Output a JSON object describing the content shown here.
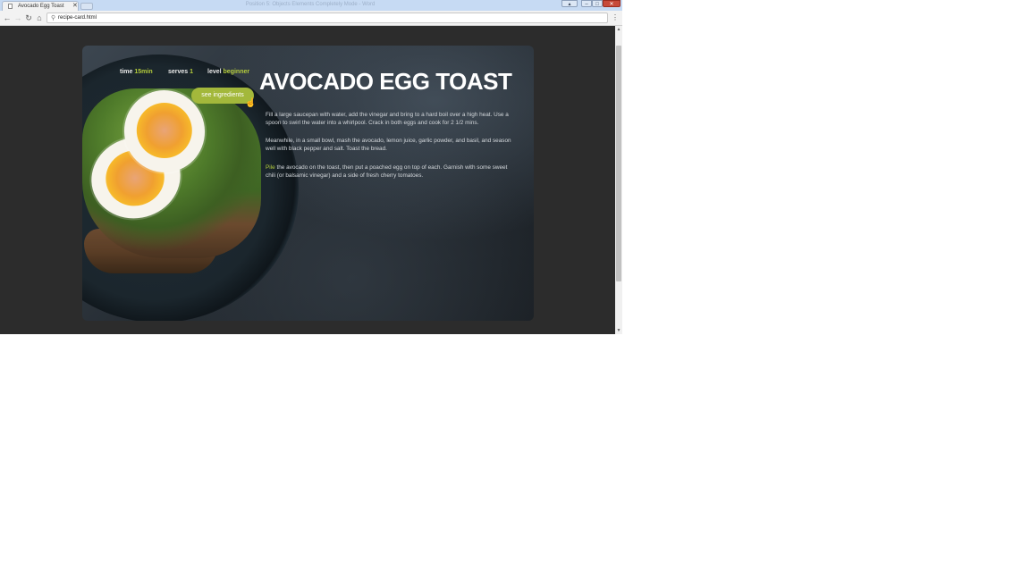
{
  "browser": {
    "tab_title": "Avocado Egg Toast",
    "window_title": "Position 5: Objects Elements Completely Mode - Word",
    "address": "recipe-card.html"
  },
  "recipe": {
    "title": "AVOCADO EGG TOAST",
    "meta": {
      "time_label": "time",
      "time_value": "15min",
      "serves_label": "serves",
      "serves_value": "1",
      "level_label": "level",
      "level_value": "beginner"
    },
    "button_label": "see ingredients",
    "steps": [
      {
        "text": "Fill a large saucepan with water, add the vinegar and bring to a hard boil over a high heat. Use a spoon to swirl the water into a whirlpool. Crack in both eggs and cook for 2 1/2 mins."
      },
      {
        "text": "Meanwhile, in a small bowl, mash the avocado, lemon juice, garlic powder, and basil, and season well with black pepper and salt. Toast the bread."
      },
      {
        "lead": "Pile",
        "text": " the avocado on the toast, then put a poached egg on top of each. Garnish with some sweet chili (or balsamic vinegar) and a side of fresh cherry tomatoes."
      }
    ]
  },
  "colors": {
    "accent": "#a3b83b",
    "page_bg": "#2c2c2c"
  },
  "icons": [
    "page-icon",
    "close-icon",
    "back-arrow-icon",
    "forward-arrow-icon",
    "reload-icon",
    "home-icon",
    "search-icon",
    "menu-dots-icon",
    "cursor-icon"
  ]
}
